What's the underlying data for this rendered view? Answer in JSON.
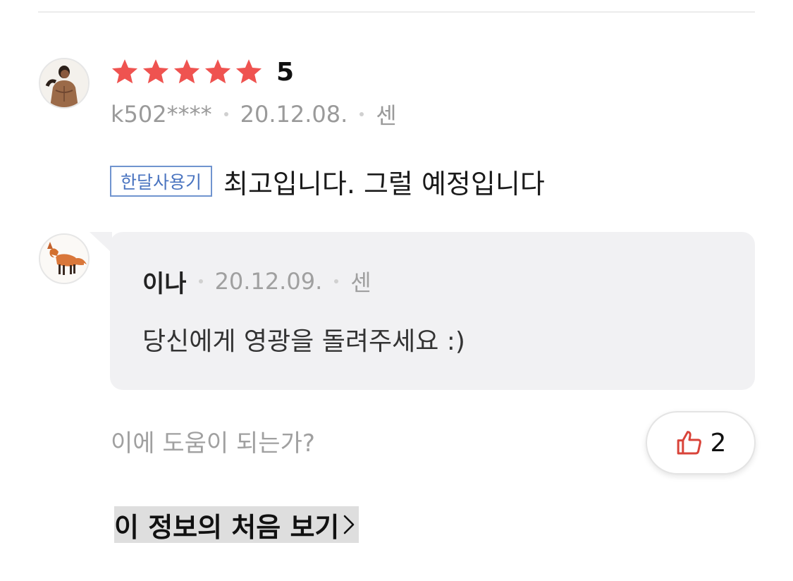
{
  "review": {
    "rating_value": "5",
    "stars_filled": 5,
    "star_color": "#ef5350",
    "username": "k502****",
    "date": "20.12.08.",
    "device": "센",
    "badge": "한달사용기",
    "text": "최고입니다. 그럴 예정입니다"
  },
  "reply": {
    "name": "이나",
    "date": "20.12.09.",
    "device": "센",
    "text": "당신에게 영광을 돌려주세요 :)"
  },
  "helpful": {
    "question": "이에 도움이 되는가?",
    "like_count": "2",
    "like_icon_color": "#d9443a"
  },
  "first_view": {
    "label": "이 정보의 처음 보기"
  },
  "colors": {
    "badge_border": "#7094cf",
    "badge_text": "#4a74c0",
    "reply_bg": "#f1f1f3"
  }
}
